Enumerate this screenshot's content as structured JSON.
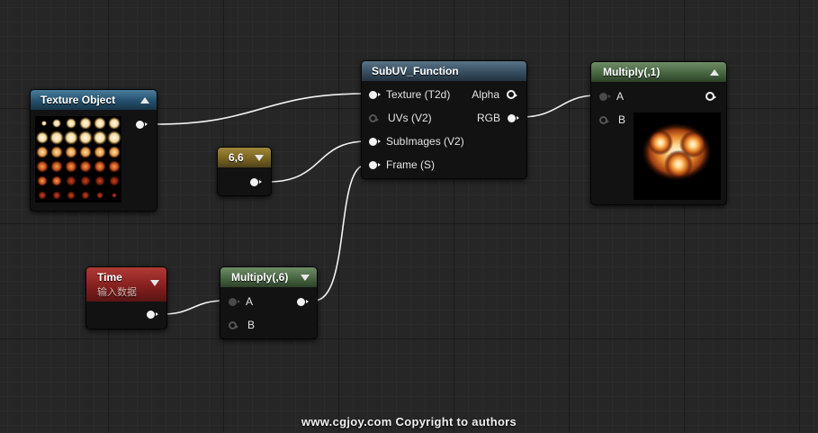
{
  "nodes": {
    "texture_object": {
      "title": "Texture Object"
    },
    "constant": {
      "title": "6,6"
    },
    "subuv": {
      "title": "SubUV_Function",
      "inputs": [
        "Texture (T2d)",
        "UVs (V2)",
        "SubImages (V2)",
        "Frame (S)"
      ],
      "outputs": [
        "Alpha",
        "RGB"
      ]
    },
    "multiply_out": {
      "title": "Multiply(,1)",
      "inputs": [
        "A",
        "B"
      ]
    },
    "time": {
      "title": "Time",
      "subtitle": "输入数据"
    },
    "multiply_time": {
      "title": "Multiply(,6)",
      "inputs": [
        "A",
        "B"
      ]
    }
  },
  "colors": {
    "texture_header": "#23506d",
    "function_header": "#364e60",
    "math_header": "#476641",
    "constant_header": "#786422",
    "time_header": "#85201e",
    "wire": "#f2f2f2"
  },
  "icons": [
    "collapse-arrow-icon",
    "expand-arrow-icon",
    "pin-icon"
  ],
  "watermark": "www.cgjoy.com  Copyright to authors"
}
